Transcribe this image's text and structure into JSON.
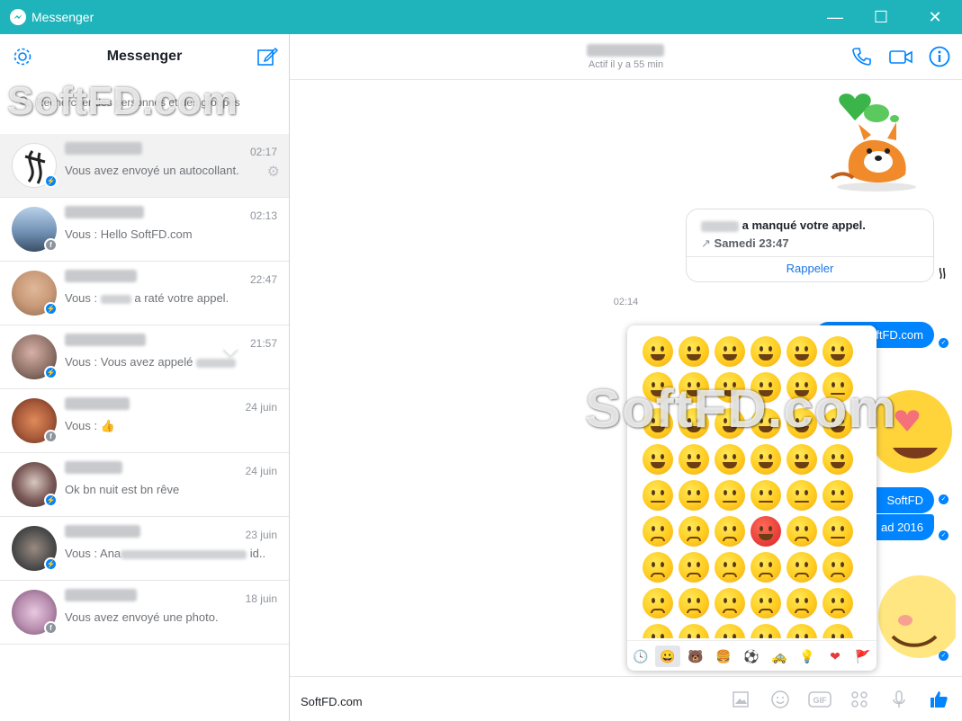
{
  "window": {
    "title": "Messenger",
    "minimize": "—",
    "maximize": "☐",
    "close": "✕"
  },
  "watermark": "SoftFD.com",
  "sidebar": {
    "title": "Messenger",
    "search_placeholder": "Rechercher des personnes et des groupes",
    "conversations": [
      {
        "time": "02:17",
        "snippet": "Vous avez envoyé un autocollant.",
        "badge": "messenger",
        "avatar_color": "#2d2d2d"
      },
      {
        "time": "02:13",
        "snippet": "Vous : Hello SoftFD.com",
        "badge": "facebook",
        "avatar_color": "#6c8cb0"
      },
      {
        "time": "22:47",
        "snippet_prefix": "Vous :",
        "snippet_suffix": "a raté votre appel.",
        "badge": "messenger",
        "avatar_color": "#c99a78"
      },
      {
        "time": "21:57",
        "snippet": "Vous : Vous avez appelé",
        "badge": "messenger",
        "avatar_color": "#8a6e64"
      },
      {
        "time": "24 juin",
        "snippet": "Vous :",
        "badge": "facebook",
        "avatar_color": "#a85a3a"
      },
      {
        "time": "24 juin",
        "snippet": "Ok bn nuit est bn rêve",
        "badge": "messenger",
        "avatar_color": "#7b5a58"
      },
      {
        "time": "23 juin",
        "snippet_prefix": "Vous : Ana",
        "snippet_suffix": "id..",
        "badge": "messenger",
        "avatar_color": "#4c4c4c"
      },
      {
        "time": "18 juin",
        "snippet": "Vous avez envoyé une photo.",
        "badge": "facebook",
        "avatar_color": "#b78cae"
      }
    ]
  },
  "header": {
    "status": "Actif il y a 55 min"
  },
  "chat": {
    "missed_call": "a manqué votre appel.",
    "missed_time": "Samedi 23:47",
    "callback": "Rappeler",
    "timestamp": "02:14",
    "messages": [
      "ftFD.com",
      "SoftFD",
      "ad 2016"
    ]
  },
  "emoji_picker": {
    "tabs": [
      "🕓",
      "😀",
      "🐻",
      "🍔",
      "⚽",
      "🚕",
      "💡",
      "❤",
      "🚩"
    ],
    "active_tab": 1
  },
  "composer": {
    "value": "SoftFD.com"
  },
  "colors": {
    "accent": "#0084ff",
    "titlebar": "#1fb4bb"
  }
}
